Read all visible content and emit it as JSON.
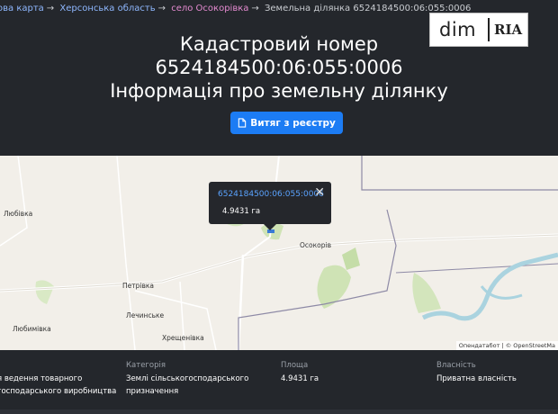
{
  "breadcrumbs": [
    {
      "label": "ова карта",
      "style": "link"
    },
    {
      "label": "Херсонська область",
      "style": "link"
    },
    {
      "label": "село Осокорівка",
      "style": "pink"
    },
    {
      "label": "Земельна ділянка 6524184500:06:055:0006",
      "style": "plain"
    }
  ],
  "breadcrumb_separator": "→",
  "logo": {
    "text": "dim",
    "mark": "RIA"
  },
  "title": {
    "line1": "Кадастровий номер",
    "line2": "6524184500:06:055:0006",
    "line3": "Інформація про земельну ділянку"
  },
  "extract_button": {
    "label": "Витяг з реєстру",
    "icon": "document-icon"
  },
  "map": {
    "places": [
      "Любівка",
      "Петрівка",
      "Лечинське",
      "Любимівка",
      "Хрещенівка",
      "Осокорів"
    ],
    "popup": {
      "cadastre": "6524184500:06:055:0006",
      "area": "4.9431 га"
    },
    "attribution": "Опендатабот | © OpenStreetMa"
  },
  "info": [
    {
      "header": "",
      "value_line1": "я ведення товарного",
      "value_line2": "господарського виробництва"
    },
    {
      "header": "Категорія",
      "value_line1": "Землі сільськогосподарського",
      "value_line2": "призначення"
    },
    {
      "header": "Площа",
      "value_line1": "4.9431 га",
      "value_line2": ""
    },
    {
      "header": "Власність",
      "value_line1": "Приватна власність",
      "value_line2": ""
    }
  ],
  "colors": {
    "accent": "#1c7cf4",
    "background": "#24272c",
    "link": "#8fb8ff",
    "pink": "#e58bd1"
  }
}
